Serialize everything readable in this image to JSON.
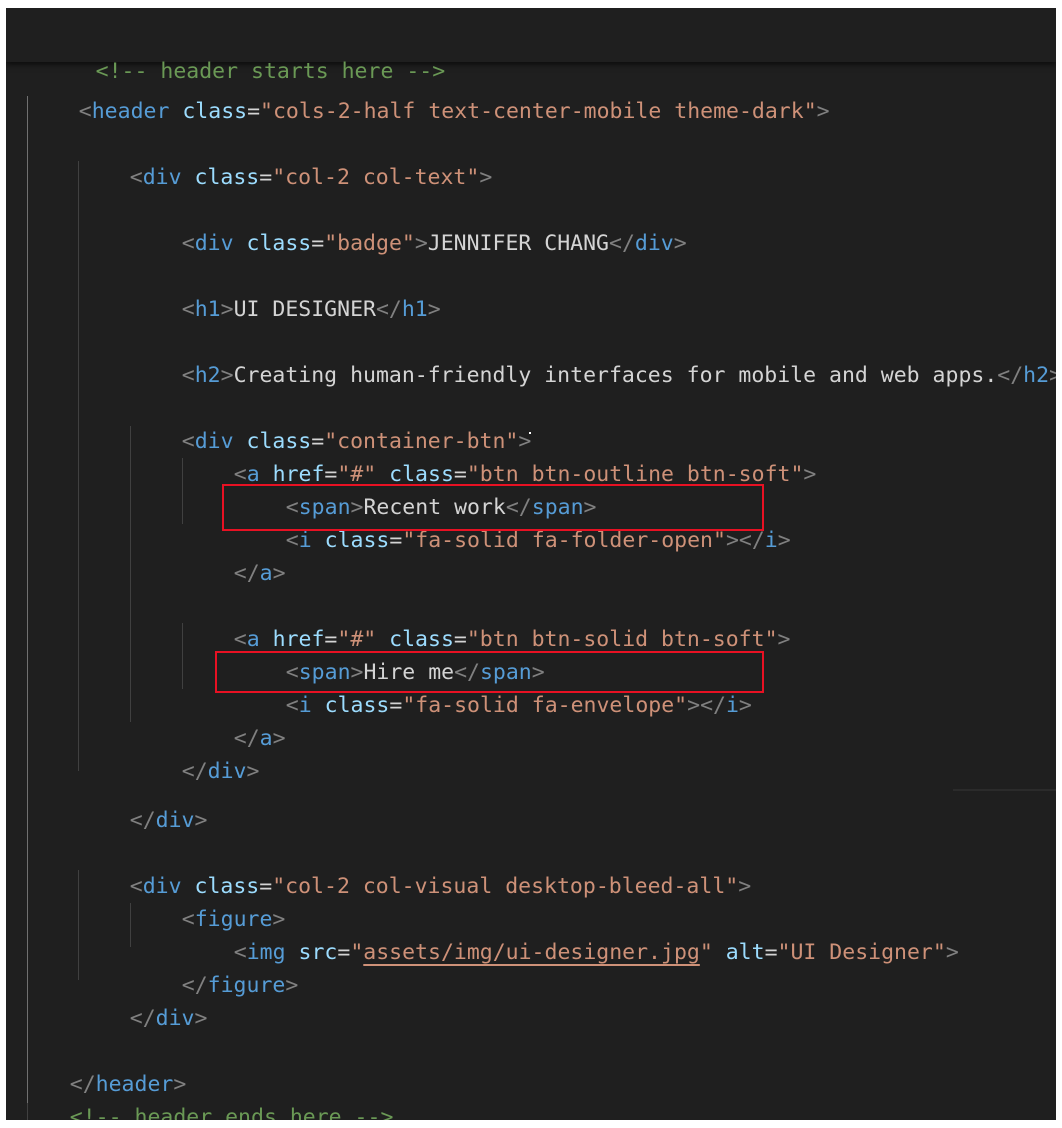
{
  "editor": {
    "theme": "dark",
    "lines": {
      "comment_start": "<!-- header starts here -->",
      "header_open": {
        "tag": "header",
        "attr": "class",
        "value": "\"cols-2-half text-center-mobile theme-dark\""
      },
      "col_text_open": {
        "tag": "div",
        "attr": "class",
        "value": "\"col-2 col-text\""
      },
      "badge": {
        "tag": "div",
        "attr": "class",
        "value": "\"badge\"",
        "text": "JENNIFER CHANG"
      },
      "h1": {
        "tag": "h1",
        "text": "UI DESIGNER"
      },
      "h2": {
        "tag": "h2",
        "text": "Creating human-friendly interfaces for mobile and web apps."
      },
      "container_open": {
        "tag": "div",
        "attr": "class",
        "value": "\"container-btn\""
      },
      "a1_open": {
        "tag": "a",
        "attr1": "href",
        "value1": "\"#\"",
        "attr2": "class",
        "value2": "\"btn btn-outline btn-soft\""
      },
      "a1_span": {
        "tag": "span",
        "text": "Recent work"
      },
      "a1_icon": {
        "tag": "i",
        "attr": "class",
        "value": "\"fa-solid fa-folder-open\""
      },
      "a_close": {
        "tag": "a"
      },
      "a2_open": {
        "tag": "a",
        "attr1": "href",
        "value1": "\"#\"",
        "attr2": "class",
        "value2": "\"btn btn-solid btn-soft\""
      },
      "a2_span": {
        "tag": "span",
        "text": "Hire me"
      },
      "a2_icon": {
        "tag": "i",
        "attr": "class",
        "value": "\"fa-solid fa-envelope\""
      },
      "div_close": {
        "tag": "div"
      },
      "col_visual_open": {
        "tag": "div",
        "attr": "class",
        "value": "\"col-2 col-visual desktop-bleed-all\""
      },
      "figure": {
        "tag": "figure"
      },
      "img": {
        "tag": "img",
        "attr1": "src",
        "value1": "assets/img/ui-designer.jpg",
        "attr2": "alt",
        "value2": "\"UI Designer\""
      },
      "header_close": {
        "tag": "header"
      },
      "comment_end": "<!-- header ends here -->"
    },
    "punct": {
      "lt": "<",
      "gt": ">",
      "ltslash": "</",
      "eq": "=",
      "q": "\"",
      "sp": " "
    },
    "highlight_color": "#e81123"
  }
}
